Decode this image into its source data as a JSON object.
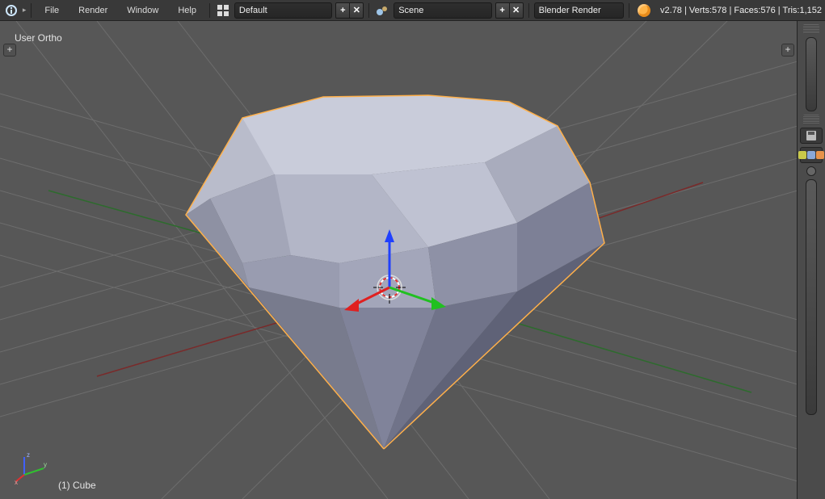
{
  "header": {
    "menus": [
      "File",
      "Render",
      "Window",
      "Help"
    ],
    "layout": "Default",
    "scene": "Scene",
    "engine": "Blender Render",
    "version": "v2.78",
    "stats": "Verts:578 | Faces:576 | Tris:1,152"
  },
  "viewport": {
    "view_label": "User Ortho",
    "object_label": "(1) Cube",
    "axes": {
      "x": "x",
      "y": "y",
      "z": "z"
    }
  }
}
